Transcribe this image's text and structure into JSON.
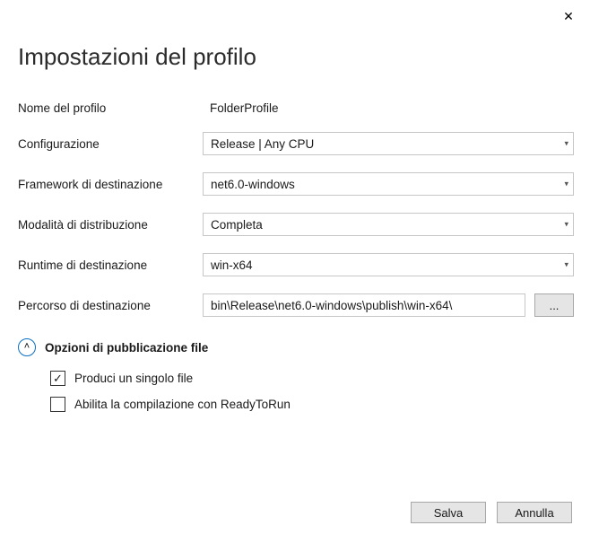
{
  "title": "Impostazioni del profilo",
  "close": "✕",
  "fields": {
    "profileName": {
      "label": "Nome del profilo",
      "value": "FolderProfile"
    },
    "configuration": {
      "label": "Configurazione",
      "value": "Release | Any CPU"
    },
    "targetFramework": {
      "label": "Framework di destinazione",
      "value": "net6.0-windows"
    },
    "deploymentMode": {
      "label": "Modalità di distribuzione",
      "value": "Completa"
    },
    "targetRuntime": {
      "label": "Runtime di destinazione",
      "value": "win-x64"
    },
    "targetLocation": {
      "label": "Percorso di destinazione",
      "value": "bin\\Release\\net6.0-windows\\publish\\win-x64\\"
    }
  },
  "browseBtn": "...",
  "expander": {
    "label": "Opzioni di pubblicazione file"
  },
  "options": {
    "singleFile": {
      "label": "Produci un singolo file",
      "checked": "✓"
    },
    "readyToRun": {
      "label": "Abilita la compilazione con ReadyToRun",
      "checked": ""
    }
  },
  "footer": {
    "save": "Salva",
    "cancel": "Annulla"
  }
}
